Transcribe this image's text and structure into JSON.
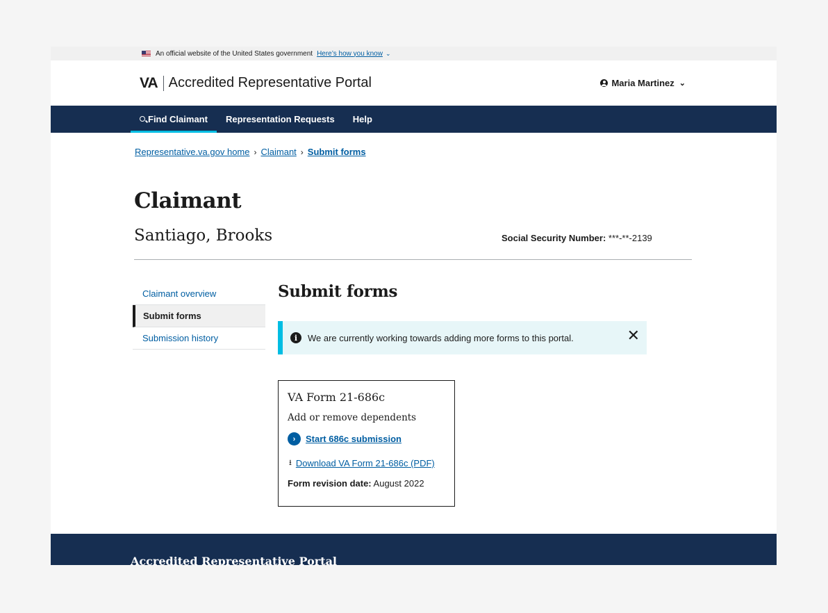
{
  "gov_banner": {
    "text": "An official website of the United States government",
    "link": "Here’s how you know"
  },
  "header": {
    "logo": "VA",
    "title": "Accredited Representative Portal",
    "user_name": "Maria Martinez"
  },
  "nav": {
    "items": [
      {
        "label": "Find Claimant"
      },
      {
        "label": "Representation Requests"
      },
      {
        "label": "Help"
      }
    ]
  },
  "breadcrumb": {
    "items": [
      "Representative.va.gov home",
      "Claimant",
      "Submit forms"
    ]
  },
  "claimant": {
    "heading": "Claimant",
    "name": "Santiago, Brooks",
    "ssn_label": "Social Security Number:",
    "ssn_value": "***-**-2139"
  },
  "side_nav": {
    "items": [
      {
        "label": "Claimant overview"
      },
      {
        "label": "Submit forms"
      },
      {
        "label": "Submission history"
      }
    ]
  },
  "content": {
    "title": "Submit forms",
    "alert_text": "We are currently working towards adding more forms to this portal."
  },
  "form_card": {
    "title": "VA Form 21-686c",
    "subtitle": "Add or remove dependents",
    "start_link": "Start 686c submission",
    "download_link": "Download VA Form 21-686c (PDF)",
    "revision_label": "Form revision date:",
    "revision_value": "August 2022"
  },
  "footer": {
    "title": "Accredited Representative Portal"
  },
  "colors": {
    "nav_bg": "#162e51",
    "link": "#005ea2",
    "alert_bg": "#e7f6f8",
    "alert_border": "#00bde3"
  }
}
